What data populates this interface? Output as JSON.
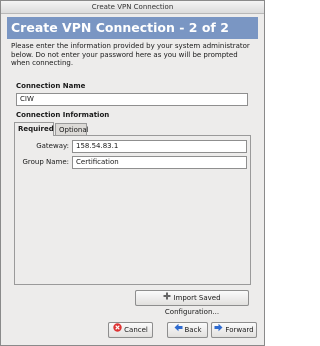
{
  "window": {
    "title": "Create VPN Connection"
  },
  "banner": {
    "title": "Create VPN Connection - 2 of 2"
  },
  "instructions": "Please enter the information provided by your system administrator below. Do not enter your password here as you will be prompted when connecting.",
  "connection_name": {
    "label": "Connection Name",
    "value": "CIW"
  },
  "connection_info": {
    "label": "Connection Information"
  },
  "tabs": [
    {
      "label": "Required"
    },
    {
      "label": "Optional"
    }
  ],
  "fields": {
    "gateway": {
      "label": "Gateway:",
      "value": "158.54.83.1"
    },
    "group_name": {
      "label": "Group Name:",
      "value": "Certification"
    }
  },
  "buttons": {
    "import": "Import Saved Configuration...",
    "cancel": "Cancel",
    "back": "Back",
    "forward": "Forward"
  },
  "colors": {
    "banner": "#7a96c3",
    "cancel_icon": "#d33",
    "nav_icon": "#2f6bd0"
  }
}
